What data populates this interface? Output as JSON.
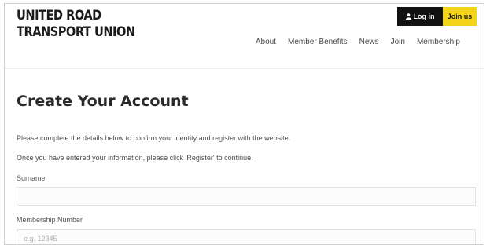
{
  "header": {
    "logo_line1": "UNITED ROAD",
    "logo_line2": "TRANSPORT UNION",
    "login_label": "Log in",
    "join_label": "Join us",
    "nav": [
      {
        "label": "About"
      },
      {
        "label": "Member Benefits"
      },
      {
        "label": "News"
      },
      {
        "label": "Join"
      },
      {
        "label": "Membership"
      }
    ],
    "search_icon": "search-icon",
    "user_icon": "user-icon"
  },
  "main": {
    "title": "Create Your Account",
    "intro_1": "Please complete the details below to confirm your identity and register with the website.",
    "intro_2": "Once you have entered your information, please click 'Register' to continue.",
    "fields": {
      "surname": {
        "label": "Surname",
        "value": "",
        "placeholder": ""
      },
      "membership_number": {
        "label": "Membership Number",
        "value": "",
        "placeholder": "e.g. 12345"
      }
    }
  },
  "colors": {
    "login_bg": "#111111",
    "join_bg": "#f4d31b",
    "text": "#333333"
  }
}
